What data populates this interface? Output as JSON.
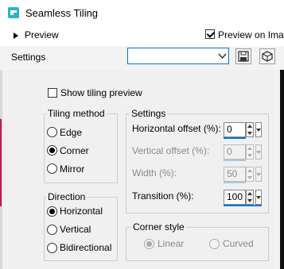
{
  "window": {
    "title": "Seamless Tiling"
  },
  "preview": {
    "label": "Preview",
    "preview_on_image_label": "Preview on Imag",
    "preview_on_image_checked": true
  },
  "settings_bar": {
    "label": "Settings",
    "preset_value": ""
  },
  "show_tiling_preview": {
    "label": "Show tiling preview",
    "checked": false
  },
  "tiling_method": {
    "title": "Tiling method",
    "options": [
      {
        "label": "Edge",
        "selected": false
      },
      {
        "label": "Corner",
        "selected": true
      },
      {
        "label": "Mirror",
        "selected": false
      }
    ]
  },
  "direction": {
    "title": "Direction",
    "options": [
      {
        "label": "Horizontal",
        "selected": true
      },
      {
        "label": "Vertical",
        "selected": false
      },
      {
        "label": "Bidirectional",
        "selected": false
      }
    ]
  },
  "settings": {
    "title": "Settings",
    "fields": [
      {
        "label": "Horizontal offset (%):",
        "value": "0",
        "enabled": true
      },
      {
        "label": "Vertical offset (%):",
        "value": "0",
        "enabled": false
      },
      {
        "label": "Width (%):",
        "value": "50",
        "enabled": false
      },
      {
        "label": "Transition (%):",
        "value": "100",
        "enabled": true
      }
    ]
  },
  "corner_style": {
    "title": "Corner style",
    "options": [
      {
        "label": "Linear",
        "selected": true,
        "enabled": false
      },
      {
        "label": "Curved",
        "selected": false,
        "enabled": false
      }
    ]
  },
  "colors": {
    "accent": "#0078d7",
    "panel_bg": "#f0f0f0",
    "app_icon": "#2bb3c8"
  }
}
